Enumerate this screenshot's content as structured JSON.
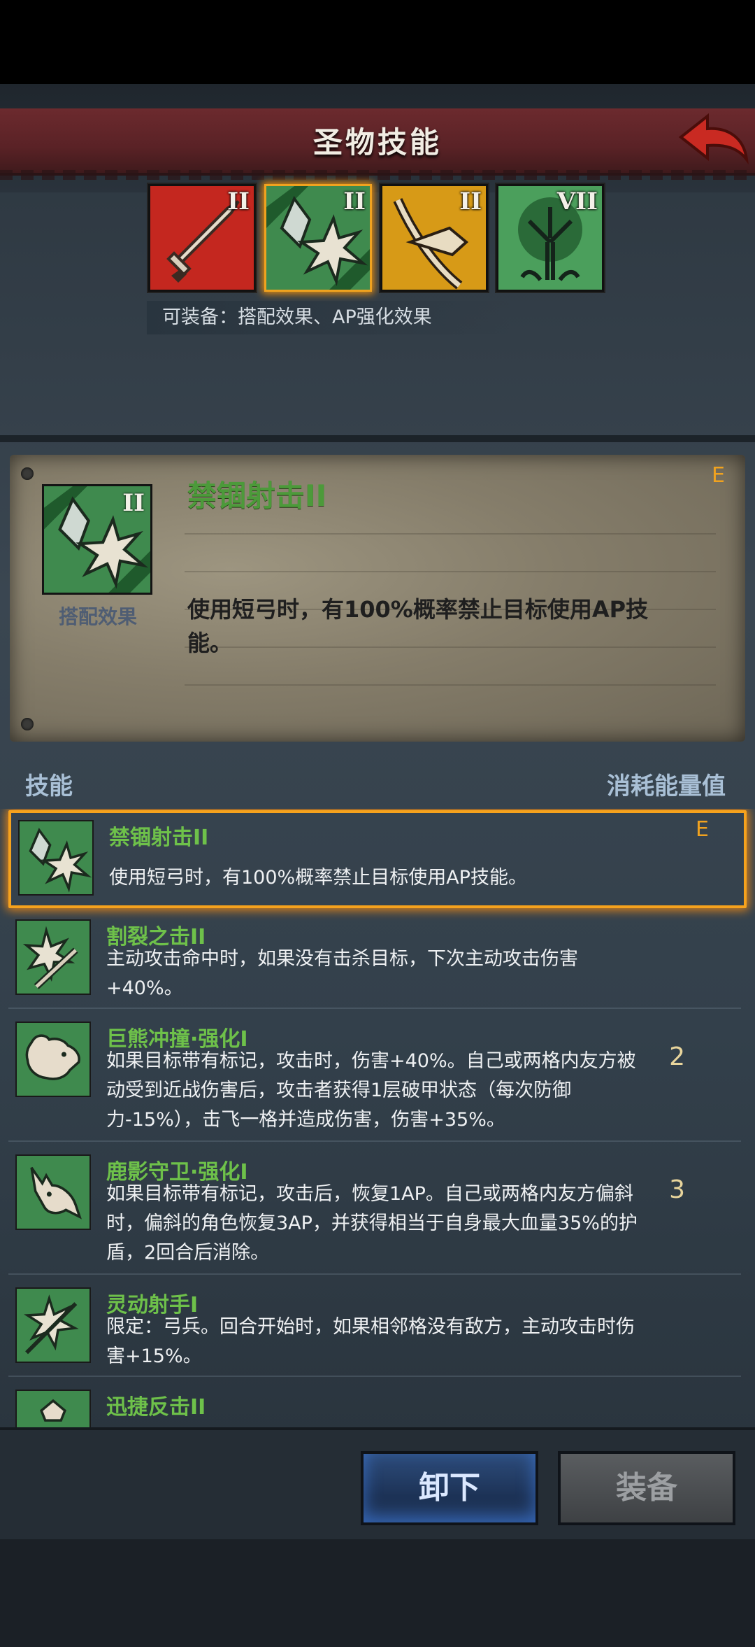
{
  "header": {
    "title": "圣物技能"
  },
  "relics": [
    {
      "name": "sword",
      "level": "II",
      "color": "#c4271f"
    },
    {
      "name": "crystal-burst",
      "level": "II",
      "color": "#3f8a4e"
    },
    {
      "name": "bow",
      "level": "II",
      "color": "#d79a17"
    },
    {
      "name": "tree",
      "level": "VII",
      "color": "#3f8a4e"
    }
  ],
  "equip_hint": "可装备：搭配效果、AP强化效果",
  "detail": {
    "level": "II",
    "type_label": "搭配效果",
    "name": "禁锢射击II",
    "description": "使用短弓时，有100%概率禁止目标使用AP技能。",
    "badge": "E"
  },
  "list_header": {
    "left": "技能",
    "right": "消耗能量值"
  },
  "skills": [
    {
      "name": "禁锢射击II",
      "desc": "使用短弓时，有100%概率禁止目标使用AP技能。",
      "cost": "",
      "badge": "E",
      "icon": "crystal-burst-icon"
    },
    {
      "name": "割裂之击II",
      "desc": "主动攻击命中时，如果没有击杀目标，下次主动攻击伤害+40%。",
      "cost": "",
      "badge": "",
      "icon": "blade-burst-icon"
    },
    {
      "name": "巨熊冲撞·强化I",
      "desc": "如果目标带有标记，攻击时，伤害+40%。自己或两格内友方被动受到近战伤害后，攻击者获得1层破甲状态（每次防御力-15%），击飞一格并造成伤害，伤害+35%。",
      "cost": "2",
      "badge": "",
      "icon": "bear-icon"
    },
    {
      "name": "鹿影守卫·强化I",
      "desc": "如果目标带有标记，攻击后，恢复1AP。自己或两格内友方偏斜时，偏斜的角色恢复3AP，并获得相当于自身最大血量35%的护盾，2回合后消除。",
      "cost": "3",
      "badge": "",
      "icon": "deer-icon"
    },
    {
      "name": "灵动射手I",
      "desc": "限定：弓兵。回合开始时，如果相邻格没有敌方，主动攻击时伤害+15%。",
      "cost": "",
      "badge": "",
      "icon": "arrow-burst-icon"
    },
    {
      "name": "迅捷反击II",
      "desc": "",
      "cost": "",
      "badge": "",
      "icon": "counter-icon"
    }
  ],
  "buttons": {
    "unequip": "卸下",
    "equip": "装备"
  }
}
